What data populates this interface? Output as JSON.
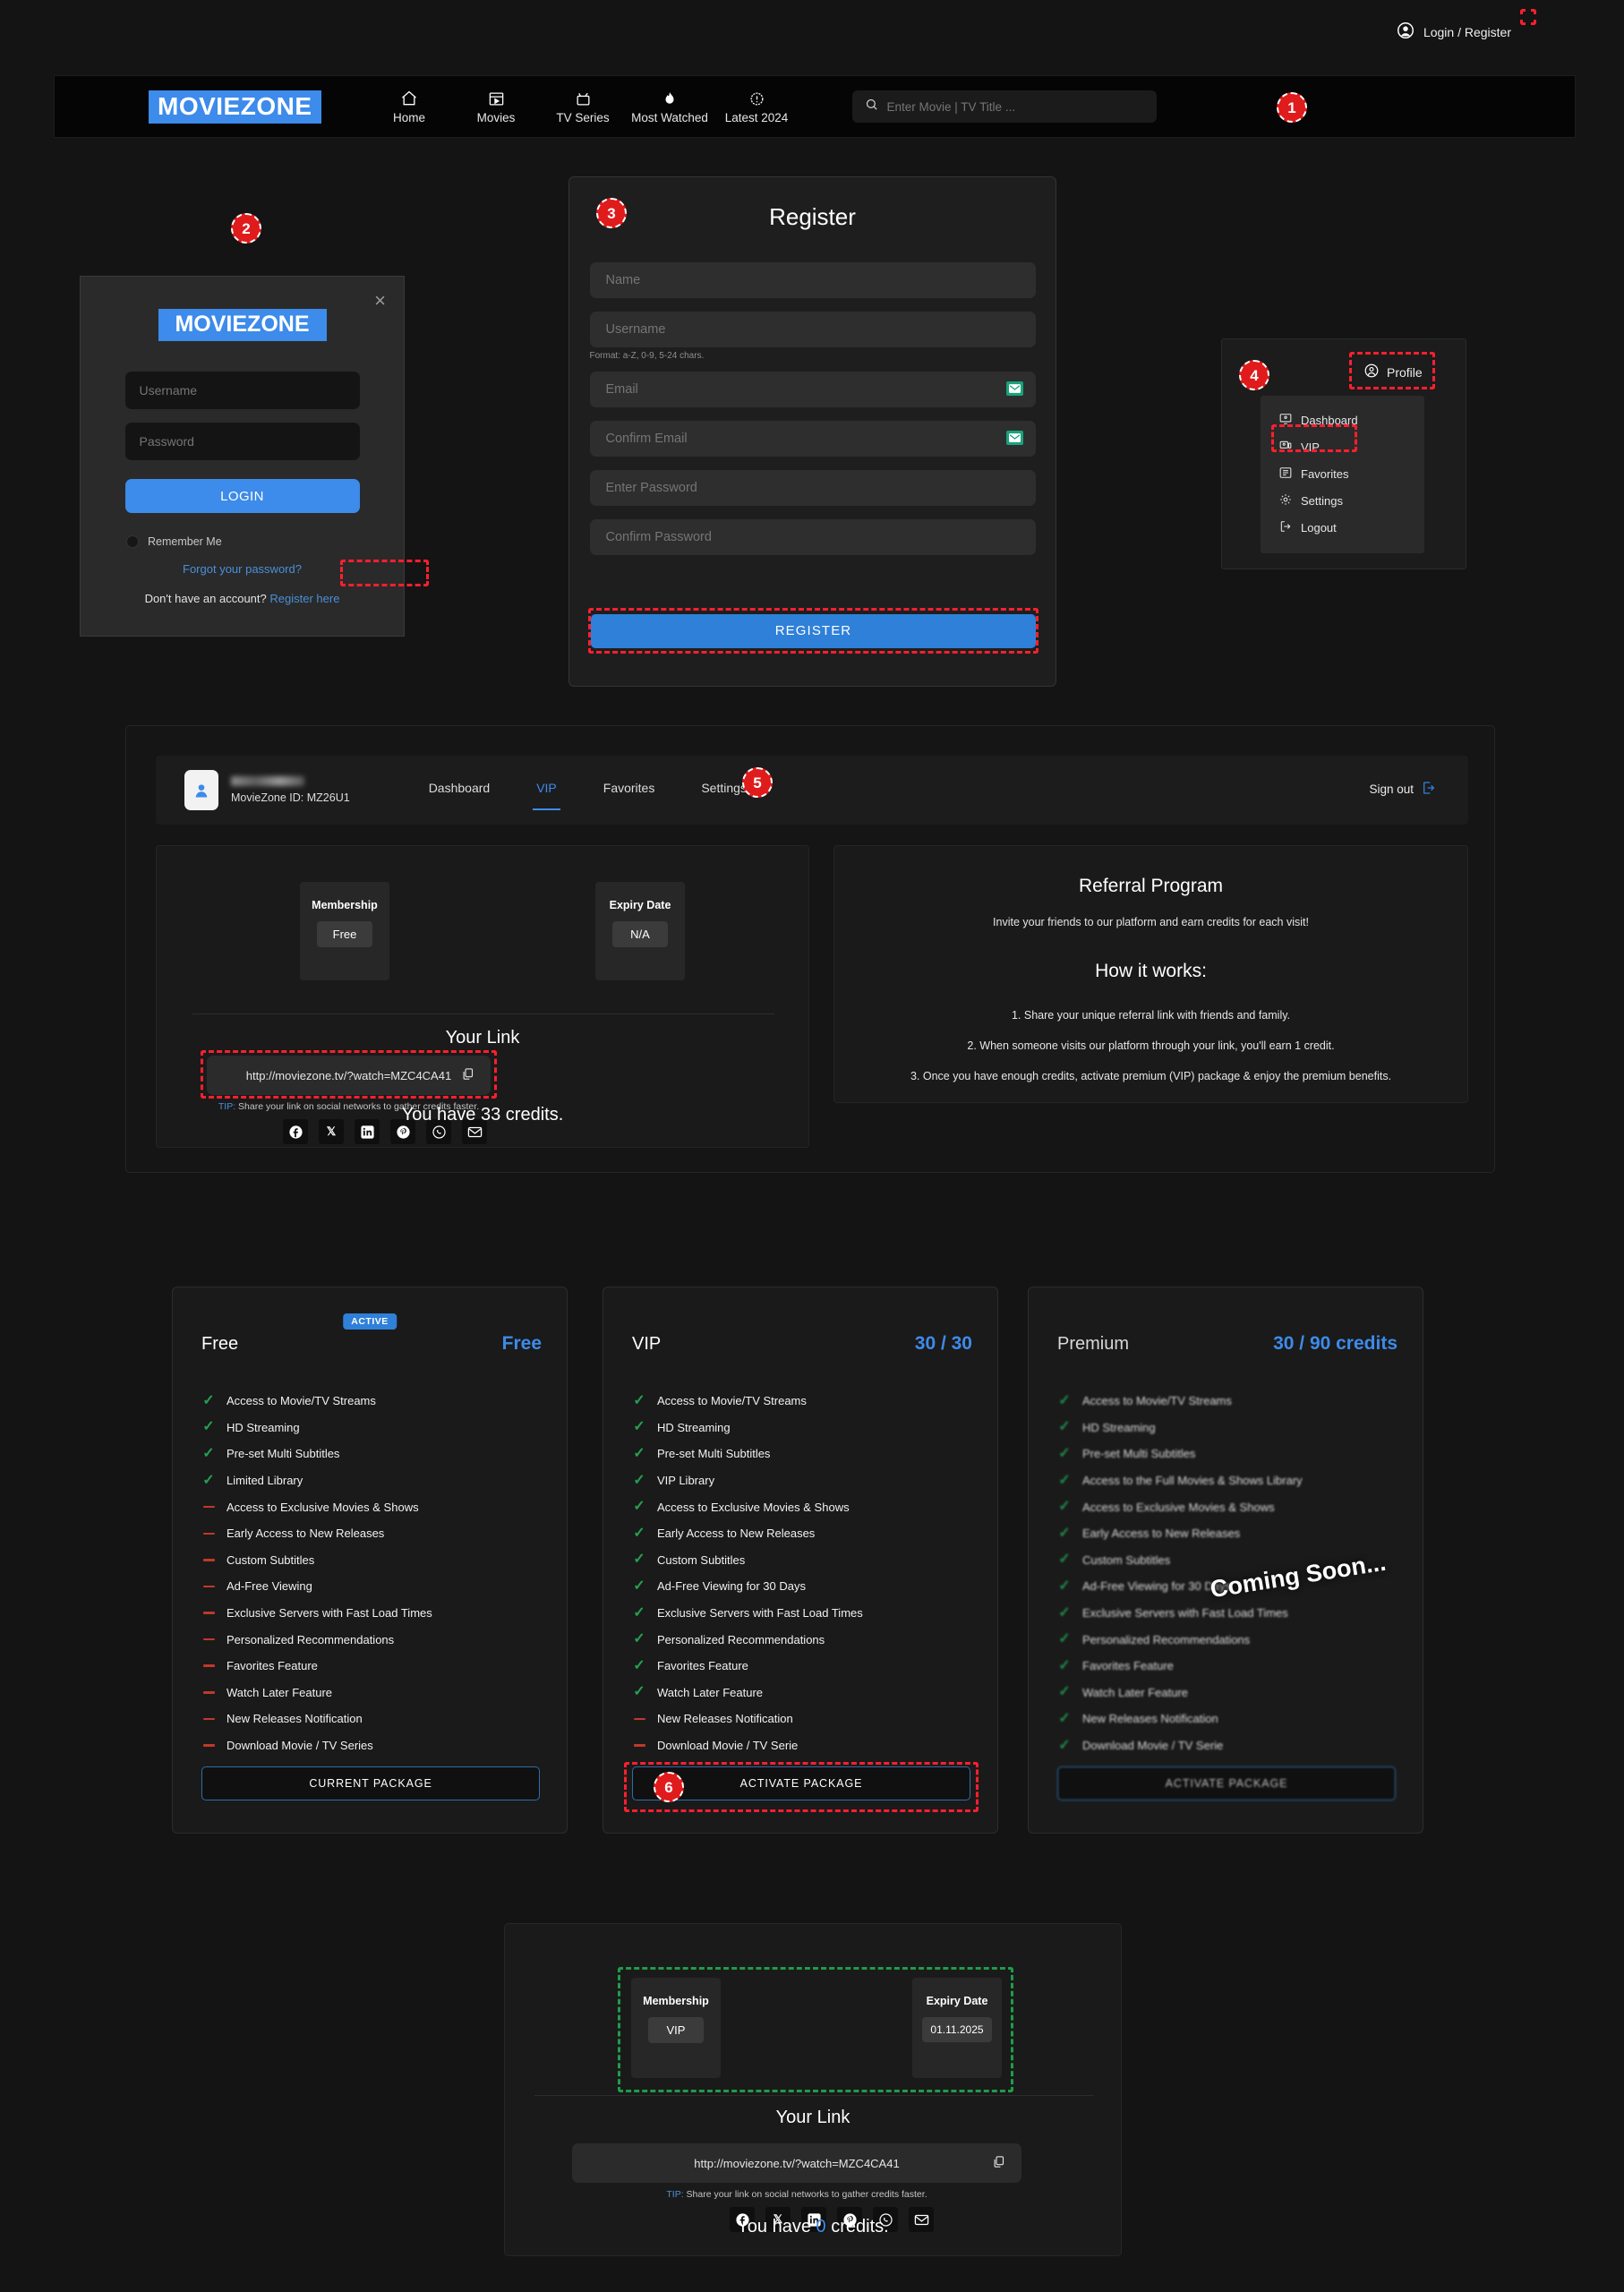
{
  "navbar": {
    "brand": "MOVIEZONE",
    "links": [
      {
        "label": "Home",
        "icon": "home-icon"
      },
      {
        "label": "Movies",
        "icon": "clapperboard-icon"
      },
      {
        "label": "TV Series",
        "icon": "tv-icon"
      },
      {
        "label": "Most Watched",
        "icon": "flame-icon"
      },
      {
        "label": "Latest 2024",
        "icon": "badge-alert-icon"
      }
    ],
    "search_placeholder": "Enter Movie | TV Title ...",
    "login_label": "Login / Register"
  },
  "login_modal": {
    "logo": "MOVIEZONE",
    "close": "×",
    "username_placeholder": "Username",
    "password_placeholder": "Password",
    "login_button": "LOGIN",
    "remember_label": "Remember Me",
    "forgot_label": "Forgot your password?",
    "no_account_text": "Don't have an account?",
    "register_here": "Register here"
  },
  "register_panel": {
    "title": "Register",
    "name_placeholder": "Name",
    "username_placeholder": "Username",
    "format_hint": "Format: a-Z, 0-9, 5-24 chars.",
    "email_placeholder": "Email",
    "confirm_email_placeholder": "Confirm Email",
    "password_placeholder": "Enter Password",
    "confirm_password_placeholder": "Confirm Password",
    "register_button": "REGISTER"
  },
  "profile_menu": {
    "profile_label": "Profile",
    "items": [
      {
        "label": "Dashboard",
        "icon": "monitor-user-icon"
      },
      {
        "label": "VIP",
        "icon": "vip-screen-icon"
      },
      {
        "label": "Favorites",
        "icon": "list-check-icon"
      },
      {
        "label": "Settings",
        "icon": "gear-icon"
      },
      {
        "label": "Logout",
        "icon": "logout-icon"
      }
    ]
  },
  "dashboard": {
    "moviezone_id": "MovieZone ID: MZ26U1",
    "tabs": [
      {
        "label": "Dashboard",
        "active": false
      },
      {
        "label": "VIP",
        "active": true
      },
      {
        "label": "Favorites",
        "active": false
      },
      {
        "label": "Settings",
        "active": false
      }
    ],
    "sign_out": "Sign out",
    "membership_title": "Membership",
    "membership_value": "Free",
    "expiry_title": "Expiry Date",
    "expiry_value": "N/A",
    "your_link_title": "Your Link",
    "link_url": "http://moviezone.tv/?watch=MZC4CA41",
    "tip_prefix": "TIP:",
    "tip_text": " Share your link on social networks to gather credits faster.",
    "credits_text": "You have 33 credits.",
    "socials": [
      "facebook-icon",
      "x-icon",
      "linkedin-icon",
      "pinterest-icon",
      "whatsapp-icon",
      "email-icon"
    ]
  },
  "referral": {
    "title": "Referral Program",
    "subtitle": "Invite your friends to our platform and earn credits for each visit!",
    "how_title": "How it works:",
    "steps": [
      "1. Share your unique referral link with friends and family.",
      "2. When someone visits our platform through your link, you'll earn 1 credit.",
      "3. Once you have enough credits, activate premium (VIP) package & enjoy the premium benefits."
    ]
  },
  "packages": [
    {
      "name": "Free",
      "price": "Free",
      "badge": "ACTIVE",
      "button": "CURRENT PACKAGE",
      "features": [
        {
          "label": "Access to Movie/TV Streams",
          "on": true
        },
        {
          "label": "HD Streaming",
          "on": true
        },
        {
          "label": "Pre-set Multi Subtitles",
          "on": true
        },
        {
          "label": "Limited Library",
          "on": true
        },
        {
          "label": "Access to Exclusive Movies & Shows",
          "on": false
        },
        {
          "label": "Early Access to New Releases",
          "on": false
        },
        {
          "label": "Custom Subtitles",
          "on": false
        },
        {
          "label": "Ad-Free Viewing",
          "on": false
        },
        {
          "label": "Exclusive Servers with Fast Load Times",
          "on": false
        },
        {
          "label": "Personalized Recommendations",
          "on": false
        },
        {
          "label": "Favorites Feature",
          "on": false
        },
        {
          "label": "Watch Later Feature",
          "on": false
        },
        {
          "label": "New Releases Notification",
          "on": false
        },
        {
          "label": "Download Movie / TV Series",
          "on": false
        }
      ]
    },
    {
      "name": "VIP",
      "price": "30 / 30",
      "badge": "",
      "button": "ACTIVATE PACKAGE",
      "features": [
        {
          "label": "Access to Movie/TV Streams",
          "on": true
        },
        {
          "label": "HD Streaming",
          "on": true
        },
        {
          "label": "Pre-set Multi Subtitles",
          "on": true
        },
        {
          "label": "VIP Library",
          "on": true
        },
        {
          "label": "Access to Exclusive Movies & Shows",
          "on": true
        },
        {
          "label": "Early Access to New Releases",
          "on": true
        },
        {
          "label": "Custom Subtitles",
          "on": true
        },
        {
          "label": "Ad-Free Viewing for 30 Days",
          "on": true
        },
        {
          "label": "Exclusive Servers with Fast Load Times",
          "on": true
        },
        {
          "label": "Personalized Recommendations",
          "on": true
        },
        {
          "label": "Favorites Feature",
          "on": true
        },
        {
          "label": "Watch Later Feature",
          "on": true
        },
        {
          "label": "New Releases Notification",
          "on": false
        },
        {
          "label": "Download Movie / TV Serie",
          "on": false
        }
      ]
    },
    {
      "name": "Premium",
      "price": "30 / 90 credits",
      "badge": "",
      "button": "ACTIVATE PACKAGE",
      "overlay": "Coming Soon...",
      "features": [
        {
          "label": "Access to Movie/TV Streams",
          "on": true
        },
        {
          "label": "HD Streaming",
          "on": true
        },
        {
          "label": "Pre-set Multi Subtitles",
          "on": true
        },
        {
          "label": "Access to the Full Movies & Shows Library",
          "on": true
        },
        {
          "label": "Access to Exclusive Movies & Shows",
          "on": true
        },
        {
          "label": "Early Access to New Releases",
          "on": true
        },
        {
          "label": "Custom Subtitles",
          "on": true
        },
        {
          "label": "Ad-Free Viewing for 30 Days",
          "on": true
        },
        {
          "label": "Exclusive Servers with Fast Load Times",
          "on": true
        },
        {
          "label": "Personalized Recommendations",
          "on": true
        },
        {
          "label": "Favorites Feature",
          "on": true
        },
        {
          "label": "Watch Later Feature",
          "on": true
        },
        {
          "label": "New Releases Notification",
          "on": true
        },
        {
          "label": "Download Movie / TV Serie",
          "on": true
        }
      ]
    }
  ],
  "bottom_card": {
    "membership_title": "Membership",
    "membership_value": "VIP",
    "expiry_title": "Expiry Date",
    "expiry_value": "01.11.2025",
    "your_link_title": "Your Link",
    "link_url": "http://moviezone.tv/?watch=MZC4CA41",
    "tip_prefix": "TIP:",
    "tip_text": " Share your link on social networks to gather credits faster.",
    "credits_prefix": "You have ",
    "credits_number": "0",
    "credits_suffix": " credits."
  },
  "markers": [
    "1",
    "2",
    "3",
    "4",
    "5",
    "6"
  ],
  "colors": {
    "accent": "#3d8bea",
    "marker": "#e01b1b",
    "check": "#22a152",
    "cross": "#c0392b",
    "highlight": "#ff1f2e",
    "highlight_green": "#1e9c4a"
  }
}
